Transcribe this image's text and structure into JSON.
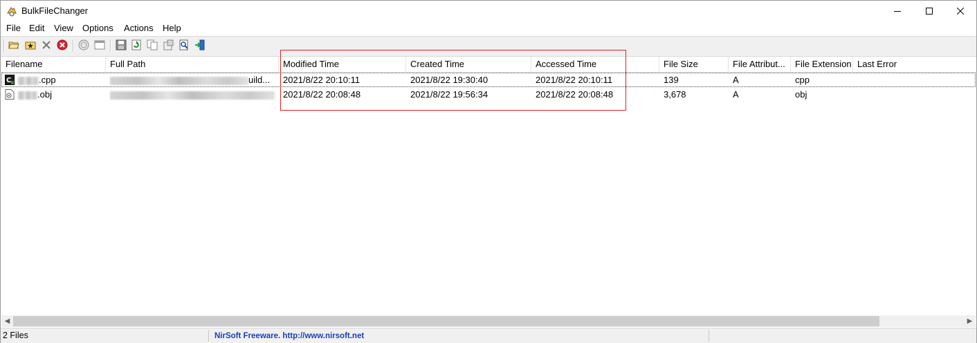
{
  "window": {
    "title": "BulkFileChanger",
    "icon": "bulkfilechanger-app-icon",
    "controls": [
      "minimize-icon",
      "maximize-icon",
      "close-icon"
    ]
  },
  "menu": [
    {
      "label": "File"
    },
    {
      "label": "Edit"
    },
    {
      "label": "View"
    },
    {
      "label": "Options"
    },
    {
      "label": "Actions"
    },
    {
      "label": "Help"
    }
  ],
  "toolbar": {
    "buttons": [
      "open-folder-icon",
      "add-files-icon",
      "delete-icon",
      "stop-icon",
      "change-time-icon",
      "window-icon",
      "save-icon",
      "refresh-icon",
      "copy-icon",
      "properties-icon",
      "find-icon",
      "exit-icon"
    ]
  },
  "columns": [
    {
      "label": "Filename"
    },
    {
      "label": "Full Path"
    },
    {
      "label": "Modified Time"
    },
    {
      "label": "Created Time"
    },
    {
      "label": "Accessed Time"
    },
    {
      "label": "File Size"
    },
    {
      "label": "File Attribut..."
    },
    {
      "label": "File Extension"
    },
    {
      "label": "Last Error"
    }
  ],
  "rows": [
    {
      "filename_suffix": ".cpp",
      "full_path_suffix": "uild...",
      "modified": "2021/8/22 20:10:11",
      "created": "2021/8/22 19:30:40",
      "accessed": "2021/8/22 20:10:11",
      "size": "139",
      "attributes": "A",
      "extension": "cpp",
      "last_error": ""
    },
    {
      "filename_suffix": ".obj",
      "full_path_suffix": "",
      "modified": "2021/8/22 20:08:48",
      "created": "2021/8/22 19:56:34",
      "accessed": "2021/8/22 20:08:48",
      "size": "3,678",
      "attributes": "A",
      "extension": "obj",
      "last_error": ""
    }
  ],
  "status": {
    "count": "2 Files",
    "credit": "NirSoft Freeware.  http://www.nirsoft.net"
  },
  "colors": {
    "highlight_box": "#e02020",
    "status_link": "#1a3fb3"
  }
}
